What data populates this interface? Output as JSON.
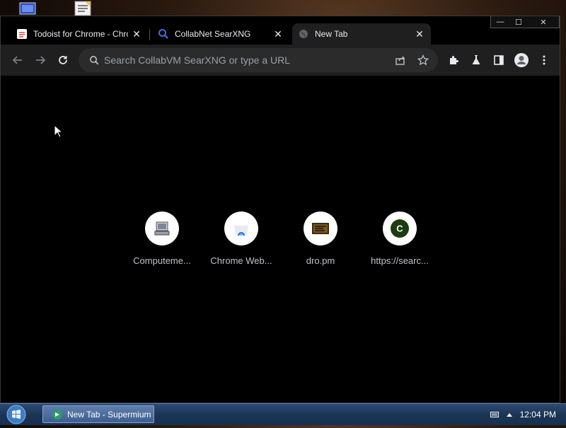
{
  "browser": {
    "tabs": [
      {
        "title": "Todoist for Chrome - Chrome",
        "active": false
      },
      {
        "title": "CollabNet SearXNG",
        "active": false
      },
      {
        "title": "New Tab",
        "active": true
      }
    ],
    "window_controls": {
      "minimize": "—",
      "maximize": "☐",
      "close": "✕"
    },
    "omnibox": {
      "placeholder": "Search CollabVM SearXNG or type a URL",
      "value": ""
    },
    "shortcuts": [
      {
        "label": "Computeme...",
        "icon": "computer-icon"
      },
      {
        "label": "Chrome Web...",
        "icon": "chrome-web-store-icon"
      },
      {
        "label": "dro.pm",
        "icon": "dro-pm-icon"
      },
      {
        "label": "https://searc...",
        "icon": "letter-c-icon",
        "letter": "C"
      }
    ]
  },
  "taskbar": {
    "task_item": "New Tab - Supermium",
    "clock": "12:04 PM"
  },
  "colors": {
    "toolbar": "#1f1f1f",
    "content_bg": "#000000",
    "taskbar": "#1b3556",
    "shortcut_c_bg": "#1e3b13"
  }
}
